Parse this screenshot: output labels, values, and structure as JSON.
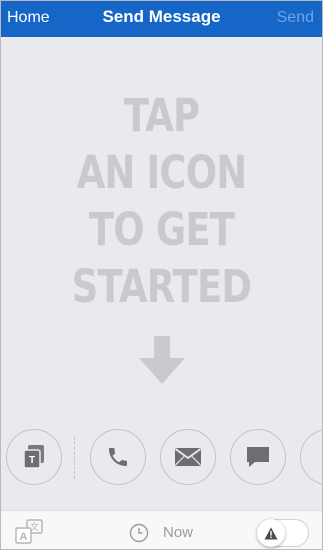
{
  "header": {
    "left_label": "Home",
    "title": "Send Message",
    "right_label": "Send"
  },
  "prompt": {
    "lines": [
      "TAP",
      "AN ICON",
      "TO GET",
      "STARTED"
    ]
  },
  "icons": [
    {
      "name": "text-card-icon"
    },
    {
      "name": "phone-icon"
    },
    {
      "name": "mail-icon"
    },
    {
      "name": "chat-bubble-icon"
    },
    {
      "name": "partial-icon"
    }
  ],
  "bottom_bar": {
    "time_label": "Now",
    "translate_icon": "translate-icon",
    "clock_icon": "clock-icon",
    "alert_icon": "warning-icon"
  },
  "colors": {
    "header_bg": "#1566c6",
    "accent_disabled": "#6fa3e6",
    "prompt_text": "#c9c9cf",
    "background": "#e9e9ee"
  }
}
